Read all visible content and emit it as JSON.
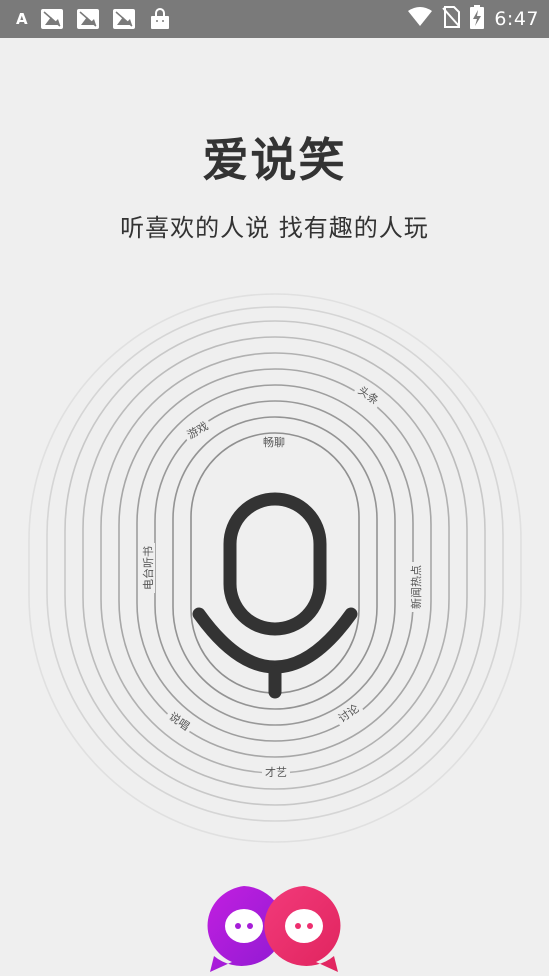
{
  "status_bar": {
    "time": "6:47",
    "left_icons": [
      "app-store-icon",
      "image-notification-icon",
      "image-notification-icon",
      "image-notification-icon",
      "shopping-bag-icon"
    ],
    "right_icons": [
      "wifi-icon",
      "no-sim-icon",
      "battery-charging-icon"
    ]
  },
  "app": {
    "title": "爱说笑",
    "slogan": "听喜欢的人说 找有趣的人玩"
  },
  "topics": {
    "chat": "畅聊",
    "games": "游戏",
    "headlines": "头条",
    "radio_audiobooks": "电台听书",
    "hot_news": "新闻热点",
    "singing": "说唱",
    "discussion": "讨论",
    "talent": "才艺"
  },
  "colors": {
    "status_bar": "#7a7a7a",
    "background": "#efefef",
    "text": "#333333",
    "ring": "#8a8a8a",
    "mic": "#333333",
    "logo_left": "#a61ed8",
    "logo_right": "#ee2f6e"
  },
  "icons": {
    "microphone": "microphone-icon",
    "logo": "chat-bubbles-logo"
  }
}
